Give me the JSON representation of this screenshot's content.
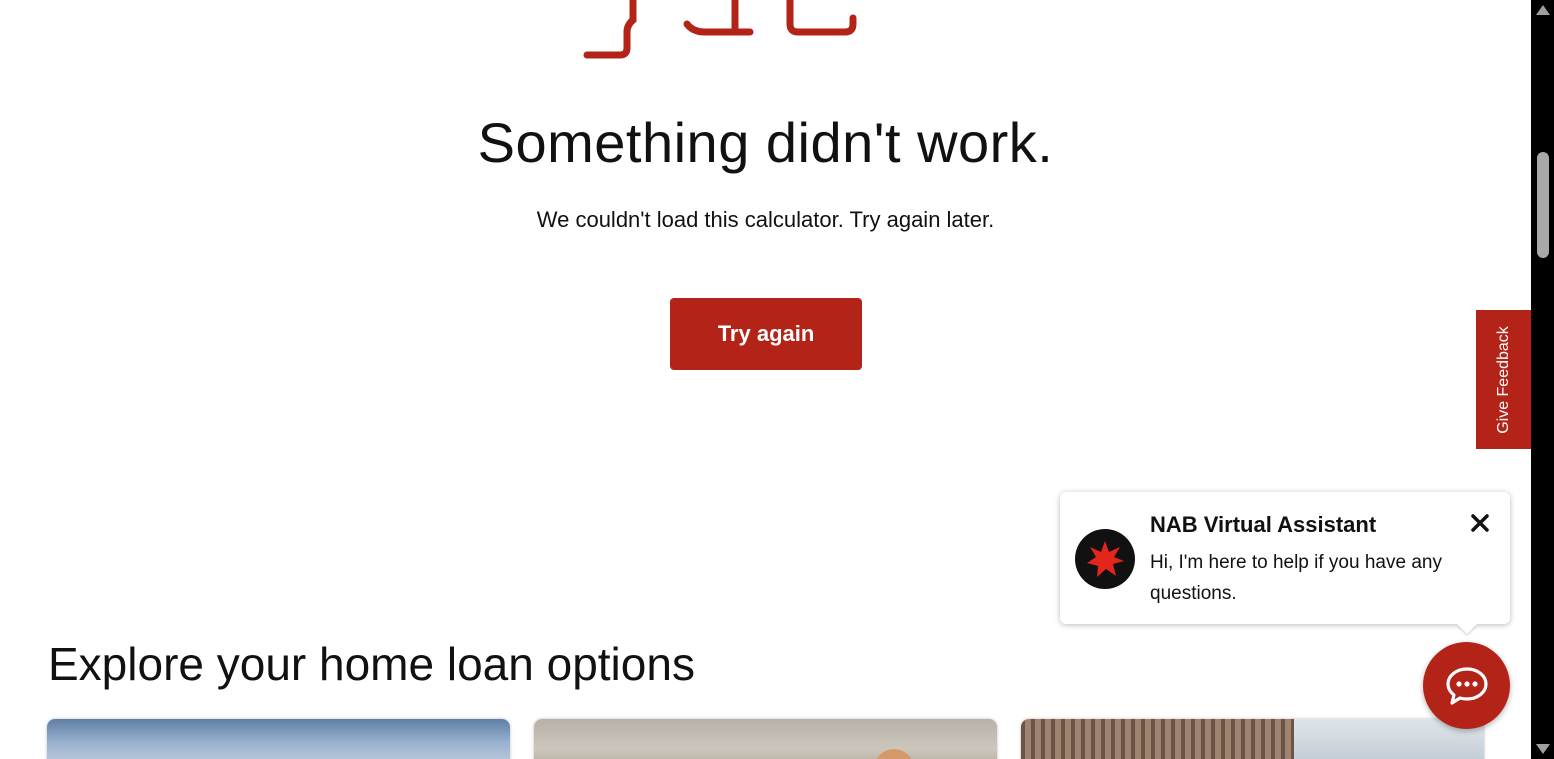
{
  "error": {
    "title": "Something didn't work.",
    "message": "We couldn't load this calculator. Try again later.",
    "retry_label": "Try again"
  },
  "explore": {
    "heading": "Explore your home loan options"
  },
  "feedback": {
    "label": "Give Feedback"
  },
  "assistant": {
    "title": "NAB Virtual Assistant",
    "message": "Hi, I'm here to help if you have any questions.",
    "avatar_icon": "nab-star-icon",
    "close_icon": "close-icon",
    "chat_icon": "chat-bubble-icon"
  },
  "colors": {
    "brand_red": "#b32317",
    "text": "#111111",
    "background": "#ffffff"
  }
}
